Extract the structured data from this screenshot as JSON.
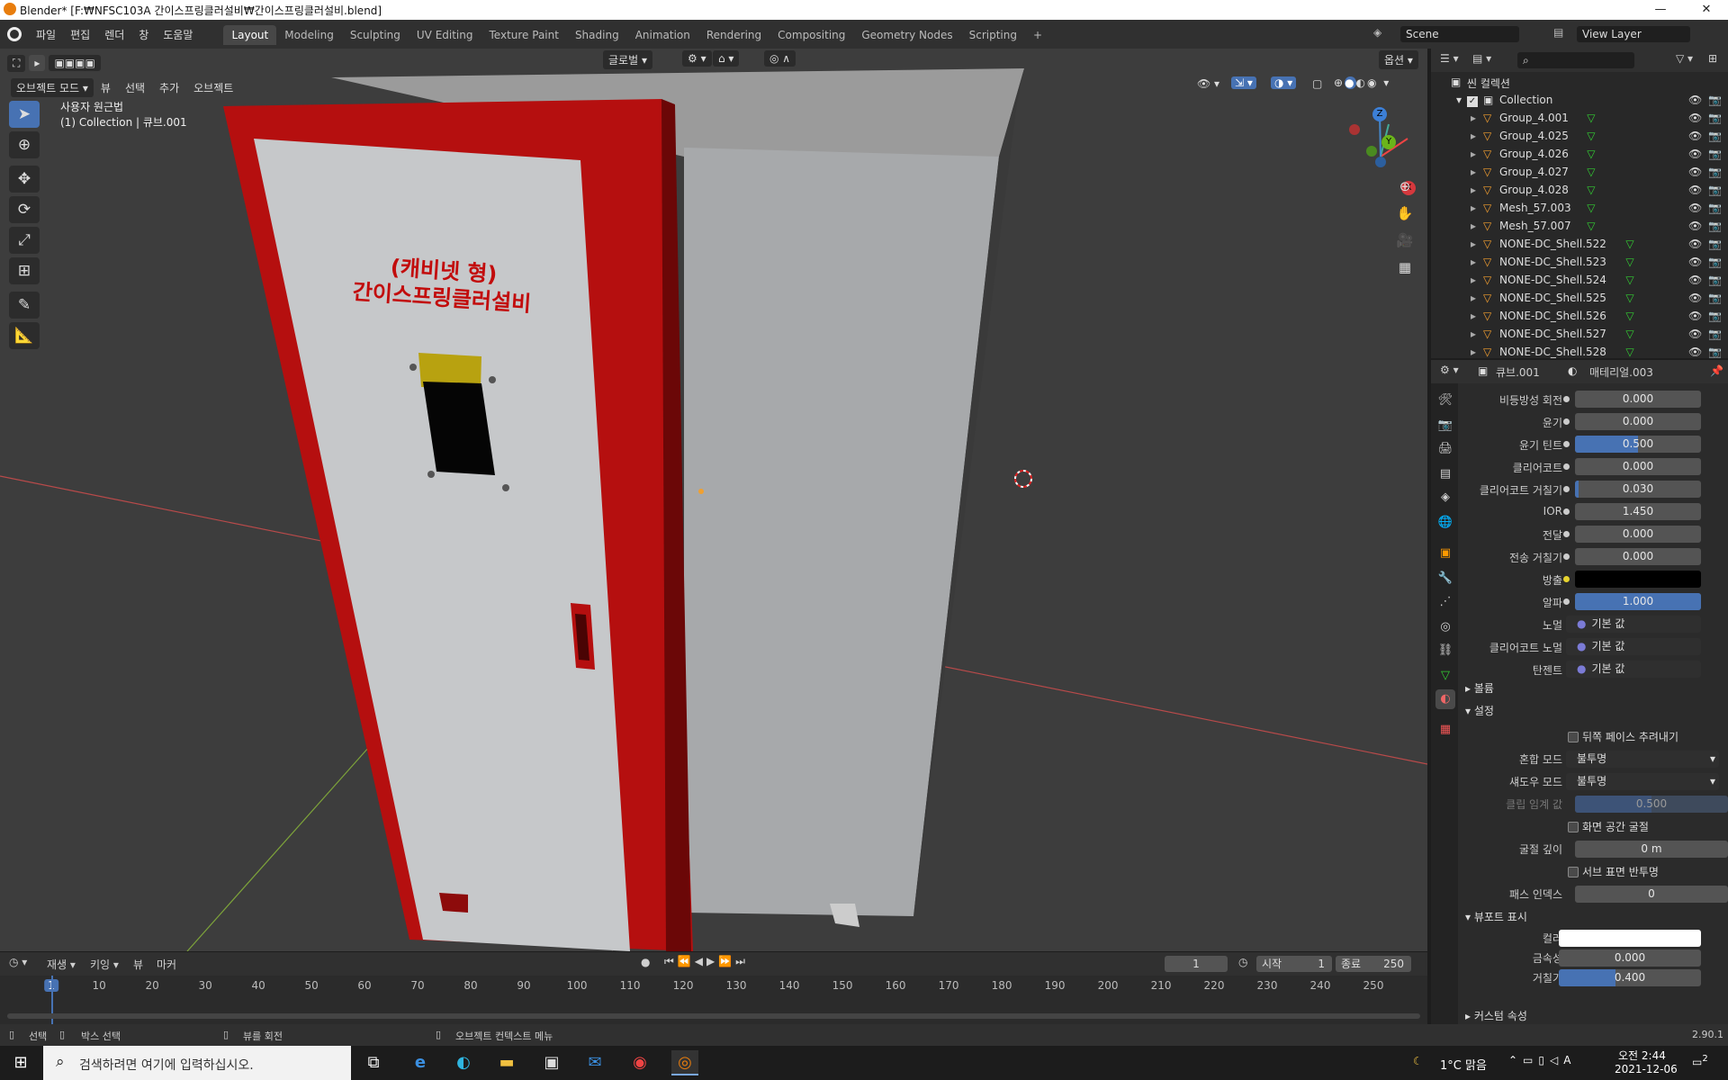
{
  "window": {
    "title": "Blender* [F:₩NFSC103A 간이스프링클러설비₩간이스프링클러설비.blend]",
    "min": "—",
    "max": "❐",
    "close": "✕"
  },
  "menu": [
    "파일",
    "편집",
    "렌더",
    "창",
    "도움말"
  ],
  "workspaces": [
    "Layout",
    "Modeling",
    "Sculpting",
    "UV Editing",
    "Texture Paint",
    "Shading",
    "Animation",
    "Rendering",
    "Compositing",
    "Geometry Nodes",
    "Scripting",
    "+"
  ],
  "scene": {
    "scene_name": "Scene",
    "view_layer": "View Layer"
  },
  "viewport": {
    "mode": "오브젝트 모드",
    "menus": [
      "뷰",
      "선택",
      "추가",
      "오브젝트"
    ],
    "transform": "글로벌",
    "options": "옵션",
    "info_line1": "사용자 원근법",
    "info_line2": "(1) Collection | 큐브.001",
    "cabinet_label_1": "(캐비넷 형)",
    "cabinet_label_2": "간이스프링클러설비",
    "gizmo": {
      "x": "X",
      "y": "Y",
      "z": "Z"
    }
  },
  "tools": [
    "select-box",
    "cursor",
    "move",
    "rotate",
    "scale",
    "transform",
    "annotate",
    "measure"
  ],
  "outliner": {
    "scene_collection": "씬 컬렉션",
    "collection": "Collection",
    "items": [
      "Group_4.001",
      "Group_4.025",
      "Group_4.026",
      "Group_4.027",
      "Group_4.028",
      "Mesh_57.003",
      "Mesh_57.007",
      "NONE-DC_Shell.522",
      "NONE-DC_Shell.523",
      "NONE-DC_Shell.524",
      "NONE-DC_Shell.525",
      "NONE-DC_Shell.526",
      "NONE-DC_Shell.527",
      "NONE-DC_Shell.528"
    ]
  },
  "properties": {
    "object": "큐브.001",
    "material": "매테리얼.003",
    "rows": [
      {
        "label": "비등방성 회전",
        "value": "0.000",
        "fill": 0
      },
      {
        "label": "윤기",
        "value": "0.000",
        "fill": 0
      },
      {
        "label": "윤기 틴트",
        "value": "0.500",
        "fill": 0.5
      },
      {
        "label": "클리어코트",
        "value": "0.000",
        "fill": 0
      },
      {
        "label": "클리어코트 거칠기",
        "value": "0.030",
        "fill": 0.03
      },
      {
        "label": "IOR",
        "value": "1.450",
        "fill": 0
      },
      {
        "label": "전달",
        "value": "0.000",
        "fill": 0
      },
      {
        "label": "전송 거칠기",
        "value": "0.000",
        "fill": 0
      },
      {
        "label": "방출",
        "value": "",
        "fill": 0,
        "color": "#000000"
      },
      {
        "label": "알파",
        "value": "1.000",
        "fill": 1
      }
    ],
    "links": [
      {
        "label": "노멀",
        "value": "기본 값"
      },
      {
        "label": "클리어코트 노멀",
        "value": "기본 값"
      },
      {
        "label": "탄젠트",
        "value": "기본 값"
      }
    ],
    "section_volume": "볼륨",
    "section_settings": "설정",
    "backface": "뒤쪽 페이스 추려내기",
    "blend_label": "혼합 모드",
    "blend_value": "불투명",
    "shadow_label": "섀도우 모드",
    "shadow_value": "불투명",
    "clip_label": "클립 임계 값",
    "clip_value": "0.500",
    "screen_refraction": "화면 공간 굴절",
    "refraction_depth_label": "굴절 깊이",
    "refraction_depth_value": "0 m",
    "subsurface": "서브 표면 반투명",
    "pass_index_label": "패스 인덱스",
    "pass_index_value": "0",
    "section_viewport": "뷰포트 표시",
    "color_label": "컬러",
    "color_value": "#ffffff",
    "metallic_label": "금속성",
    "metallic_value": "0.000",
    "roughness_label": "거칠기",
    "roughness_value": "0.400",
    "roughness_fill": 0.4,
    "section_custom": "커스텀 속성"
  },
  "timeline": {
    "menus": [
      "재생",
      "키잉",
      "뷰",
      "마커"
    ],
    "current": "1",
    "start_label": "시작",
    "start": "1",
    "end_label": "종료",
    "end": "250",
    "ticks": [
      "1",
      "10",
      "20",
      "30",
      "40",
      "50",
      "60",
      "70",
      "80",
      "90",
      "100",
      "110",
      "120",
      "130",
      "140",
      "150",
      "160",
      "170",
      "180",
      "190",
      "200",
      "210",
      "220",
      "230",
      "240",
      "250"
    ]
  },
  "status": {
    "select": "선택",
    "box_select": "박스 선택",
    "rotate_view": "뷰를 회전",
    "context_menu": "오브젝트 컨텍스트 메뉴",
    "version": "2.90.1"
  },
  "taskbar": {
    "search": "검색하려면 여기에 입력하십시오.",
    "weather": "1°C 맑음",
    "time": "오전 2:44",
    "date": "2021-12-06",
    "notif": "2"
  },
  "colors": {
    "accent": "#4772b3",
    "cabinet_red": "#b50f0f",
    "cabinet_panel": "#c6c8ca",
    "active_ws": "#474747"
  }
}
